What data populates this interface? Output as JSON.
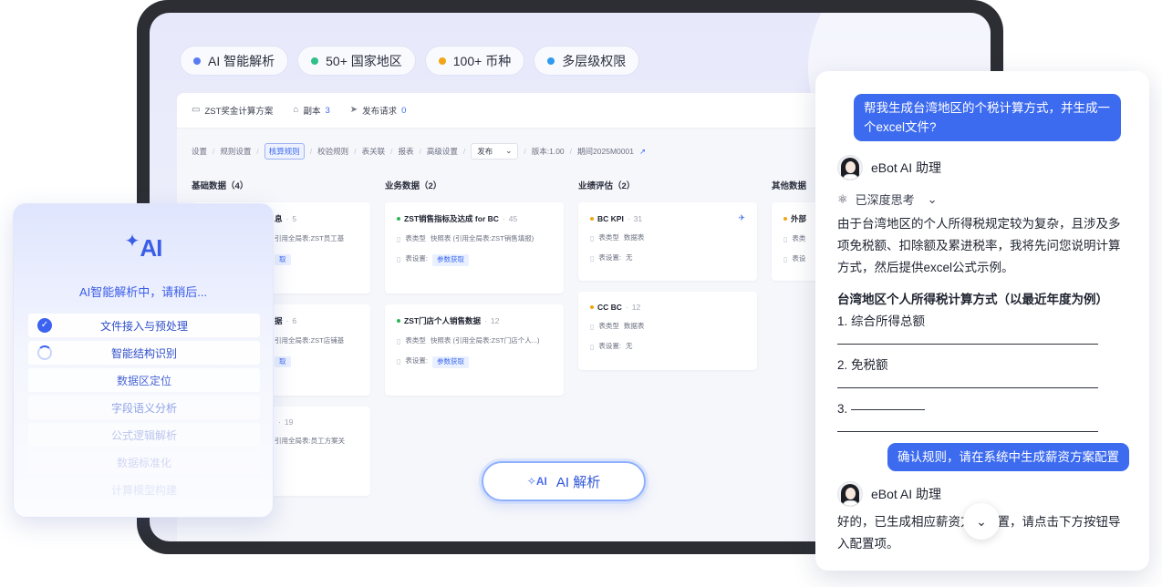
{
  "features": [
    {
      "label": "AI 智能解析",
      "color": "#5a7cf0"
    },
    {
      "label": "50+ 国家地区",
      "color": "#30c08a"
    },
    {
      "label": "100+ 币种",
      "color": "#f2a516"
    },
    {
      "label": "多层级权限",
      "color": "#2f9bf0"
    }
  ],
  "app": {
    "title": "ZST奖金计算方案",
    "copy_label": "副本",
    "copy_count": "3",
    "publish_label": "发布请求",
    "publish_count": "0",
    "crumbs": [
      "设置",
      "规则设置",
      "核算规则",
      "校验规则",
      "表关联",
      "报表",
      "高级设置"
    ],
    "publish_select": "发布",
    "version": "版本:1.00",
    "period": "期间2025M0001",
    "columns": [
      {
        "title": "基础数据（4）",
        "cards": [
          {
            "name": "息",
            "count": "5",
            "type": "引用全局表:ZST员工基",
            "setting": "取"
          },
          {
            "name": "据",
            "count": "6",
            "type": "引用全局表:ZST店铺基",
            "setting": "取"
          },
          {
            "name": "",
            "count": "19",
            "type": "引用全局表:员工方案关",
            "setting": ""
          }
        ]
      },
      {
        "title": "业务数据（2）",
        "cards": [
          {
            "name": "ZST销售指标及达成 for BC",
            "count": "45",
            "type_label": "表类型",
            "type": "快照表 (引用全局表:ZST销售填报)",
            "setting_label": "表设置:",
            "setting": "参数获取"
          },
          {
            "name": "ZST门店个人销售数据",
            "count": "12",
            "type_label": "表类型",
            "type": "快照表 (引用全局表:ZST门店个人...)",
            "setting_label": "表设置:",
            "setting": "参数获取"
          }
        ]
      },
      {
        "title": "业绩评估（2）",
        "cards": [
          {
            "name": "BC KPI",
            "count": "31",
            "type_label": "表类型",
            "type": "数据表",
            "setting_label": "表设置:",
            "setting": "无"
          },
          {
            "name": "CC BC",
            "count": "12",
            "type_label": "表类型",
            "type": "数据表",
            "setting_label": "表设置:",
            "setting": "无"
          }
        ]
      },
      {
        "title": "其他数据",
        "cards": [
          {
            "name": "外部",
            "type_label": "表类",
            "setting_label": "表设"
          }
        ]
      }
    ]
  },
  "ai_button": {
    "icon_text": "AI",
    "label": "AI 解析"
  },
  "ai_panel": {
    "logo": "AI",
    "status": "AI智能解析中，请稍后...",
    "steps": [
      {
        "label": "文件接入与预处理",
        "state": "done"
      },
      {
        "label": "智能结构识别",
        "state": "running"
      },
      {
        "label": "数据区定位",
        "state": "pending"
      },
      {
        "label": "字段语义分析",
        "state": "pending"
      },
      {
        "label": "公式逻辑解析",
        "state": "pending"
      },
      {
        "label": "数据标准化",
        "state": "pending"
      },
      {
        "label": "计算模型构建",
        "state": "pending"
      }
    ]
  },
  "chat": {
    "user_msg_1": "帮我生成台湾地区的个税计算方式，并生成一个excel文件?",
    "bot_name": "eBot AI 助理",
    "thinking_label": "已深度思考",
    "reply_1": "由于台湾地区的个人所得税规定较为复杂，且涉及多项免税额、扣除额及累进税率，我将先问您说明计算方式，然后提供excel公式示例。",
    "section_title": "台湾地区个人所得税计算方式（以最近年度为例）",
    "items": [
      "1. 综合所得总额",
      "2. 免税额",
      "3. ——————"
    ],
    "user_msg_2": "确认规则，请在系统中生成薪资方案配置",
    "bot_name_2": "eBot AI 助理",
    "reply_2": "好的，已生成相应薪资方案配置，请点击下方按钮导入配置项。"
  }
}
